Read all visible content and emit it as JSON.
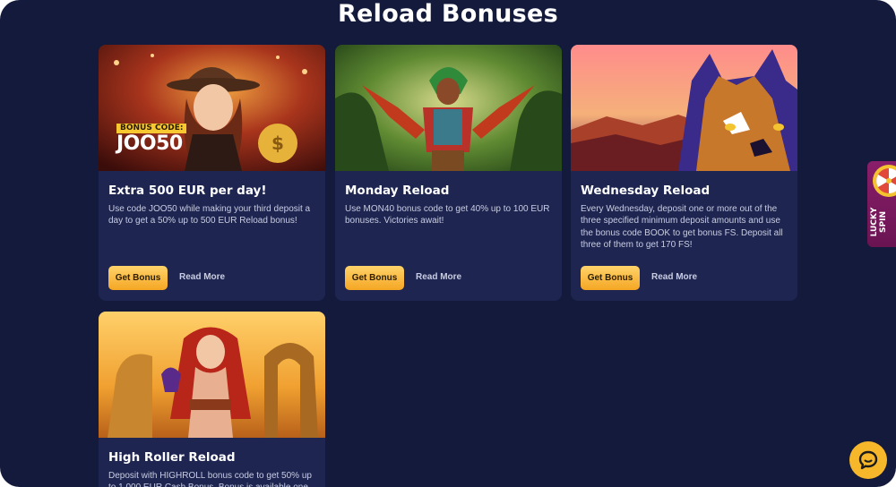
{
  "page": {
    "title": "Reload Bonuses"
  },
  "cards": [
    {
      "title": "Extra 500 EUR per day!",
      "description": "Use code JOO50 while making your third deposit a day to get a 50% up to 500 EUR Reload bonus!",
      "image_badge_label": "BONUS CODE:",
      "image_badge_code": "JOO50",
      "button_label": "Get Bonus",
      "link_label": "Read More"
    },
    {
      "title": "Monday Reload",
      "description": "Use MON40 bonus code to get 40% up to 100 EUR bonuses. Victories await!",
      "button_label": "Get Bonus",
      "link_label": "Read More"
    },
    {
      "title": "Wednesday Reload",
      "description": "Every Wednesday, deposit one or more out of the three specified minimum deposit amounts and use the bonus code BOOK to get bonus FS. Deposit all three of them to get 170 FS!",
      "button_label": "Get Bonus",
      "link_label": "Read More"
    },
    {
      "title": "High Roller Reload",
      "description": "Deposit with HIGHROLL bonus code to get 50% up to 1 000 EUR Cash Bonus. Bonus is available one time in"
    }
  ],
  "side_widget": {
    "label_line1": "LUCKY",
    "label_line2": "SPIN"
  },
  "colors": {
    "background": "#131a3b",
    "card": "#1d2550",
    "button": "#f5a623",
    "chat": "#f6b72a"
  },
  "icons": {
    "chat": "chat-bubble-icon",
    "wheel": "fortune-wheel-icon"
  }
}
